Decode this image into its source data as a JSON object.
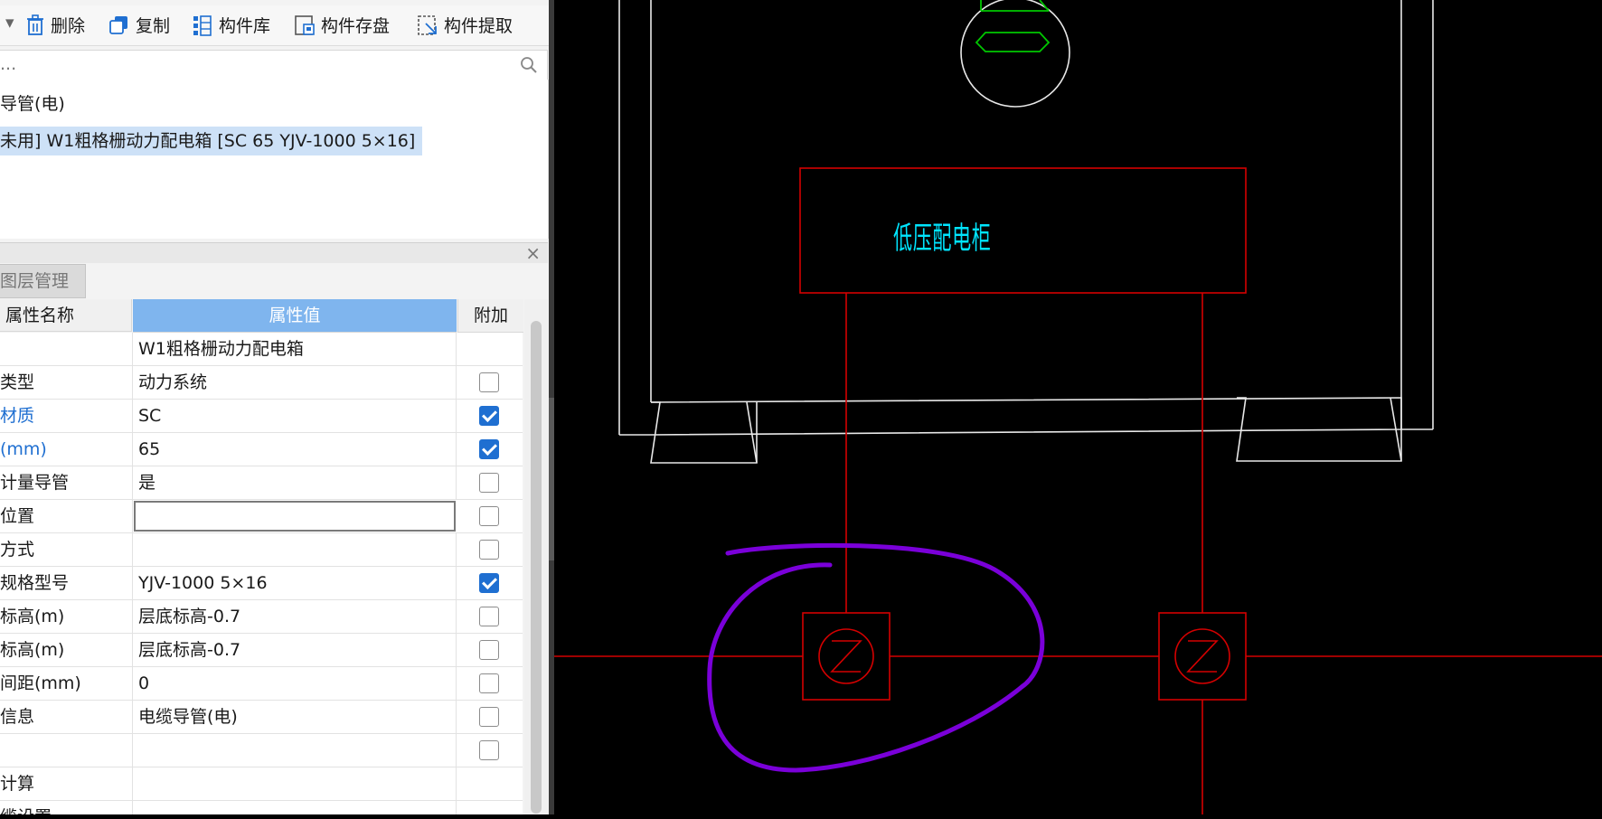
{
  "toolbar": {
    "dropdown_arrow": "▾",
    "delete_label": "删除",
    "copy_label": "复制",
    "library_label": "构件库",
    "save_label": "构件存盘",
    "extract_label": "构件提取"
  },
  "search": {
    "placeholder": "..."
  },
  "tree": {
    "items": [
      {
        "label": "导管(电)"
      },
      {
        "label": "未用] W1粗格栅动力配电箱 [SC 65 YJV-1000 5×16]",
        "selected": true
      }
    ]
  },
  "panel": {
    "tab_label": "图层管理",
    "close_glyph": "×"
  },
  "properties": {
    "header": {
      "name": "属性名称",
      "value": "属性值",
      "extra": "附加"
    },
    "rows": [
      {
        "name": "",
        "value": "W1粗格栅动力配电箱",
        "checkbox": null
      },
      {
        "name": "类型",
        "value": "动力系统",
        "checked": false
      },
      {
        "name": "材质",
        "value": "SC",
        "checked": true,
        "link": true
      },
      {
        "name": "(mm)",
        "value": "65",
        "checked": true,
        "link": true
      },
      {
        "name": "计量导管",
        "value": "是",
        "checked": false
      },
      {
        "name": "位置",
        "value": "",
        "checked": false,
        "editing": true
      },
      {
        "name": "方式",
        "value": "",
        "checked": false
      },
      {
        "name": "规格型号",
        "value": "YJV-1000 5×16",
        "checked": true
      },
      {
        "name": "标高(m)",
        "value": "层底标高-0.7",
        "checked": false
      },
      {
        "name": "标高(m)",
        "value": "层底标高-0.7",
        "checked": false
      },
      {
        "name": "间距(mm)",
        "value": "0",
        "checked": false
      },
      {
        "name": "信息",
        "value": "电缆导管(电)",
        "checked": false
      },
      {
        "name": "",
        "value": "",
        "checked": false
      },
      {
        "name": "计算",
        "value": "",
        "checkbox": null
      },
      {
        "name": "缆设置",
        "value": "",
        "checkbox": null
      }
    ]
  },
  "cad": {
    "label": "低压配电柜",
    "colors": {
      "background": "#000000",
      "equipment": "#e8e8e8",
      "cable": "#d40000",
      "annotation": "#7a00d9",
      "text": "#00e5ff",
      "valve": "#00c800"
    }
  }
}
